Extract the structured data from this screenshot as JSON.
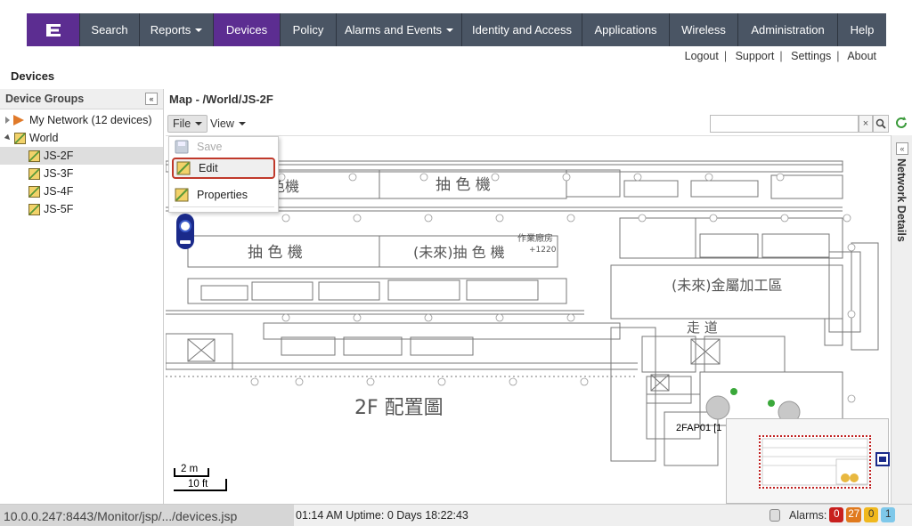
{
  "nav": {
    "logo_icon": "extreme-logo-icon",
    "items": [
      {
        "label": "Search",
        "dropdown": false
      },
      {
        "label": "Reports",
        "dropdown": true
      },
      {
        "label": "Devices",
        "dropdown": false,
        "active": true
      },
      {
        "label": "Policy",
        "dropdown": false
      },
      {
        "label": "Alarms and Events",
        "dropdown": true
      },
      {
        "label": "Identity and Access",
        "dropdown": false
      },
      {
        "label": "Applications",
        "dropdown": false
      },
      {
        "label": "Wireless",
        "dropdown": false
      },
      {
        "label": "Administration",
        "dropdown": false
      },
      {
        "label": "Help",
        "dropdown": false
      }
    ],
    "active_color": "#5c2d91"
  },
  "util_links": [
    "Logout",
    "Support",
    "Settings",
    "About"
  ],
  "page_title": "Devices",
  "device_groups": {
    "title": "Device Groups",
    "items": [
      {
        "label": "My Network (12 devices)",
        "icon": "flag-icon"
      },
      {
        "label": "World",
        "icon": "map-icon"
      },
      {
        "label": "JS-2F",
        "icon": "map-icon",
        "selected": true
      },
      {
        "label": "JS-3F",
        "icon": "map-icon"
      },
      {
        "label": "JS-4F",
        "icon": "map-icon"
      },
      {
        "label": "JS-5F",
        "icon": "map-icon"
      }
    ]
  },
  "map": {
    "title": "Map - /World/JS-2F",
    "file_label": "File",
    "view_label": "View",
    "search_value": "",
    "search_clear": "×",
    "right_panel_label": "Network Details",
    "file_menu": {
      "save": "Save",
      "edit": "Edit",
      "properties": "Properties"
    },
    "scale": {
      "meters": "2 m",
      "feet": "10 ft"
    },
    "floorplan_labels": {
      "title": "2F 配置圖",
      "extractor1": "抽 色 機",
      "extractor2": "抽 色 機",
      "extractor_future": "(未來)抽 色 機",
      "partial_machine": "色機",
      "metal_area": "(未來)金屬加工區",
      "corridor": "走 道",
      "work_area": "作業廠房",
      "elevation": "+1220",
      "ap_label": "2FAP01 [1"
    }
  },
  "status": {
    "url": "10.0.0.247:8443/Monitor/jsp/.../devices.jsp",
    "time_uptime": "01:14 AM   Uptime: 0 Days 18:22:43",
    "alarms_label": "Alarms:",
    "alarm_counts": [
      {
        "value": "0",
        "color": "#c8201e"
      },
      {
        "value": "27",
        "color": "#e07a1e"
      },
      {
        "value": "0",
        "color": "#f0b81e"
      },
      {
        "value": "1",
        "color": "#7ec8ea"
      }
    ]
  }
}
